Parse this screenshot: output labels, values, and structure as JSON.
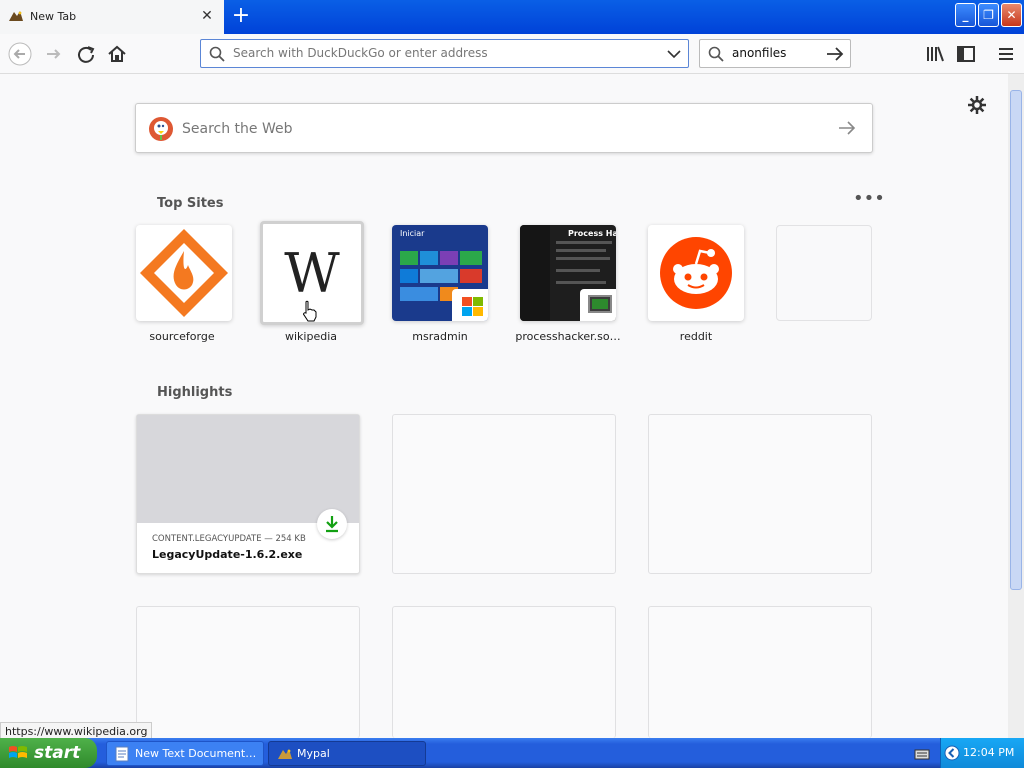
{
  "tab": {
    "title": "New Tab"
  },
  "urlbar": {
    "placeholder": "Search with DuckDuckGo or enter address"
  },
  "searchbar": {
    "value": "anonfiles"
  },
  "websearch": {
    "placeholder": "Search the Web"
  },
  "top_sites": {
    "title": "Top Sites",
    "items": [
      {
        "label": "sourceforge"
      },
      {
        "label": "wikipedia"
      },
      {
        "label": "msradmin",
        "thumb_text": "Iniciar"
      },
      {
        "label": "processhacker.so…",
        "thumb_text": "Process Hack"
      },
      {
        "label": "reddit"
      },
      {
        "label": ""
      }
    ]
  },
  "highlights": {
    "title": "Highlights",
    "cards": [
      {
        "source": "CONTENT.LEGACYUPDATE — 254 KB",
        "title": "LegacyUpdate-1.6.2.exe"
      }
    ]
  },
  "status": {
    "url": "https://www.wikipedia.org"
  },
  "taskbar": {
    "start_label": "start",
    "items": [
      {
        "label": "New Text Document...."
      },
      {
        "label": "Mypal"
      }
    ],
    "clock": "12:04 PM"
  },
  "colors": {
    "xp_blue": "#245edc",
    "start_green": "#3a9a35",
    "sourceforge_orange": "#f47920",
    "reddit_orange": "#ff4500",
    "download_green": "#12a012"
  }
}
